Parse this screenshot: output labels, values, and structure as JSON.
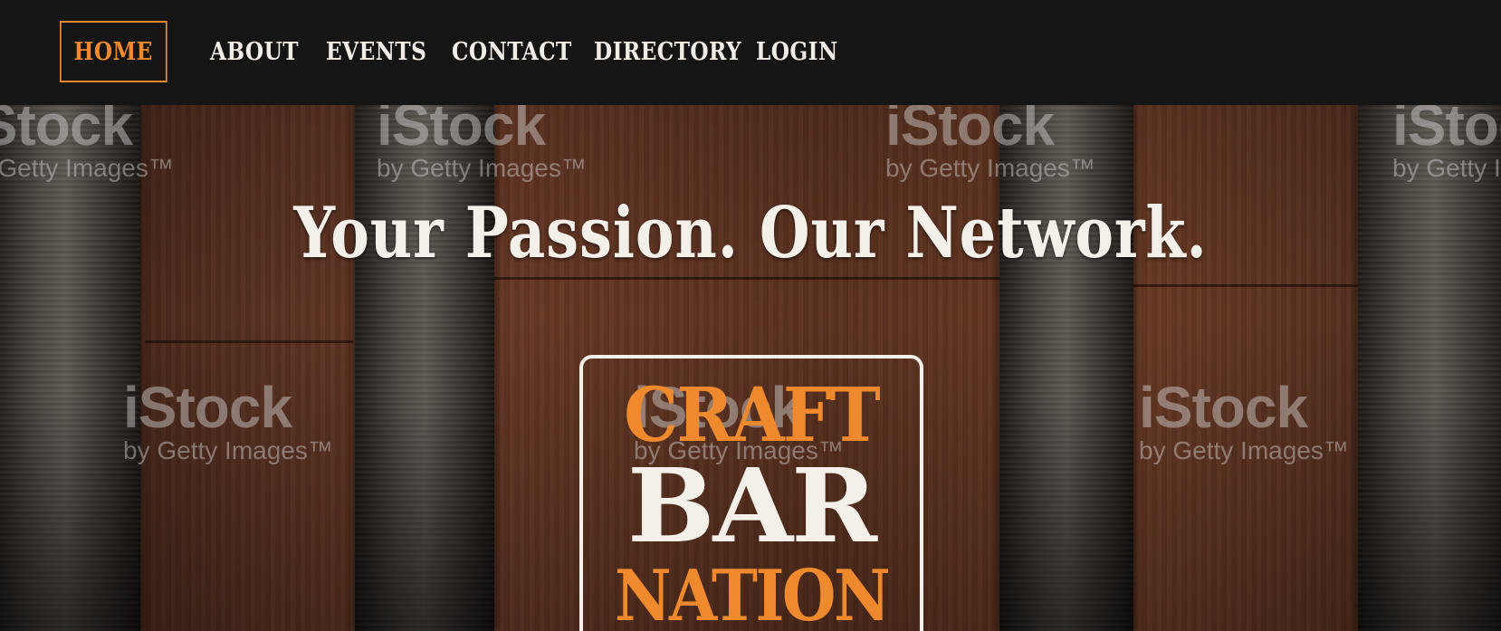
{
  "nav": {
    "items": [
      {
        "label": "HOME",
        "active": true
      },
      {
        "label": "ABOUT",
        "active": false
      },
      {
        "label": "EVENTS",
        "active": false
      },
      {
        "label": "CONTACT",
        "active": false
      },
      {
        "label": "DIRECTORY",
        "active": false
      },
      {
        "label": "LOGIN",
        "active": false
      }
    ]
  },
  "hero": {
    "tagline": "Your Passion. Our Network.",
    "logo": {
      "line1": "CRAFT",
      "line2": "BAR",
      "line3": "NATION"
    }
  },
  "watermark": {
    "brand": "iStock",
    "byline": "by Getty Images™"
  },
  "colors": {
    "accent": "#ee8a2d",
    "nav_bg": "#151515",
    "text_light": "#f3efe9"
  }
}
